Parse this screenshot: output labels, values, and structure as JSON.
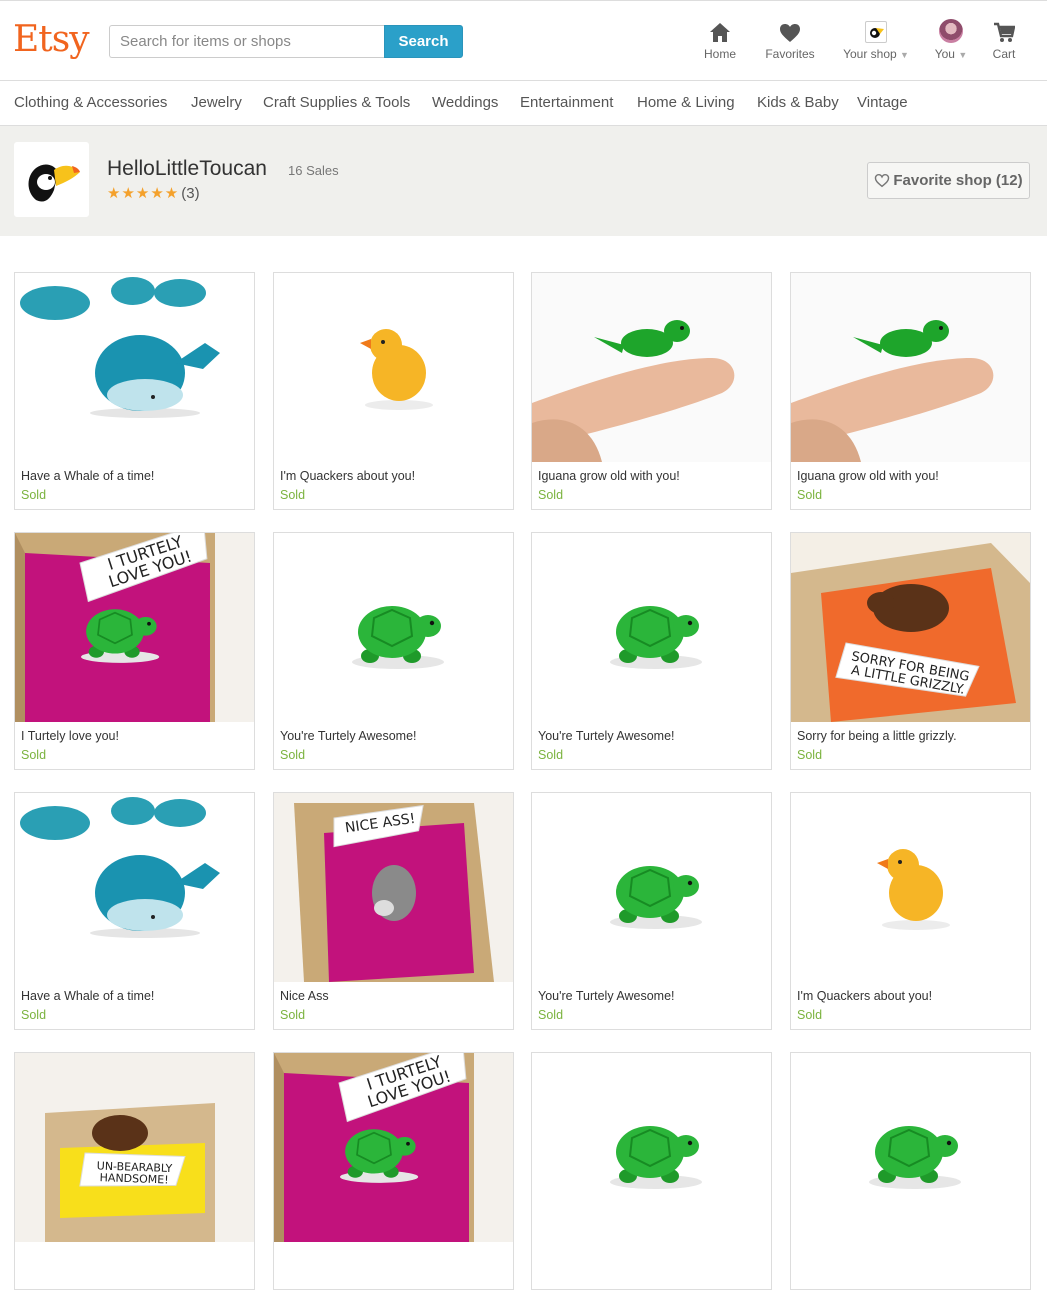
{
  "header": {
    "logo": "Etsy",
    "search_placeholder": "Search for items or shops",
    "search_button": "Search",
    "nav": [
      {
        "label": "Home",
        "icon": "home-icon"
      },
      {
        "label": "Favorites",
        "icon": "heart-icon"
      },
      {
        "label": "Your shop",
        "icon": "shop-icon"
      },
      {
        "label": "You",
        "icon": "avatar"
      },
      {
        "label": "Cart",
        "icon": "cart-icon"
      }
    ]
  },
  "categories": [
    "Clothing & Accessories",
    "Jewelry",
    "Craft Supplies & Tools",
    "Weddings",
    "Entertainment",
    "Home & Living",
    "Kids & Baby",
    "Vintage"
  ],
  "shop": {
    "name": "HelloLittleToucan",
    "sales": "16 Sales",
    "stars": "★★★★★",
    "review_count": "(3)",
    "favorite_button": "Favorite shop (12)"
  },
  "listings": [
    {
      "title": "Have a Whale of a time!",
      "status": "Sold",
      "image": "whale"
    },
    {
      "title": "I'm Quackers about you!",
      "status": "Sold",
      "image": "duck"
    },
    {
      "title": "Iguana grow old with you!",
      "status": "Sold",
      "image": "iguana"
    },
    {
      "title": "Iguana grow old with you!",
      "status": "Sold",
      "image": "iguana"
    },
    {
      "title": "I Turtely love you!",
      "status": "Sold",
      "image": "turtle-box"
    },
    {
      "title": "You're Turtely Awesome!",
      "status": "Sold",
      "image": "turtle"
    },
    {
      "title": "You're Turtely Awesome!",
      "status": "Sold",
      "image": "turtle"
    },
    {
      "title": "Sorry for being a little grizzly.",
      "status": "Sold",
      "image": "bear-box"
    },
    {
      "title": "Have a Whale of a time!",
      "status": "Sold",
      "image": "whale"
    },
    {
      "title": "Nice Ass",
      "status": "Sold",
      "image": "donkey-box"
    },
    {
      "title": "You're Turtely Awesome!",
      "status": "Sold",
      "image": "turtle"
    },
    {
      "title": "I'm Quackers about you!",
      "status": "Sold",
      "image": "duck"
    },
    {
      "title": "",
      "status": "",
      "image": "bear-box-yellow"
    },
    {
      "title": "",
      "status": "",
      "image": "turtle-box"
    },
    {
      "title": "",
      "status": "",
      "image": "turtle"
    },
    {
      "title": "",
      "status": "",
      "image": "turtle"
    }
  ],
  "image_text": {
    "turtle_sign": "I TURTELY LOVE YOU!",
    "bear_sign": "SORRY FOR BEING A LITTLE GRIZZLY.",
    "donkey_sign": "NICE ASS!",
    "bear_yellow_sign": "UN-BEARABLY HANDSOME!"
  },
  "colors": {
    "brand": "#f1641e",
    "search_button": "#2ba0c9",
    "sold": "#7bb33e",
    "star": "#f4a12c"
  }
}
